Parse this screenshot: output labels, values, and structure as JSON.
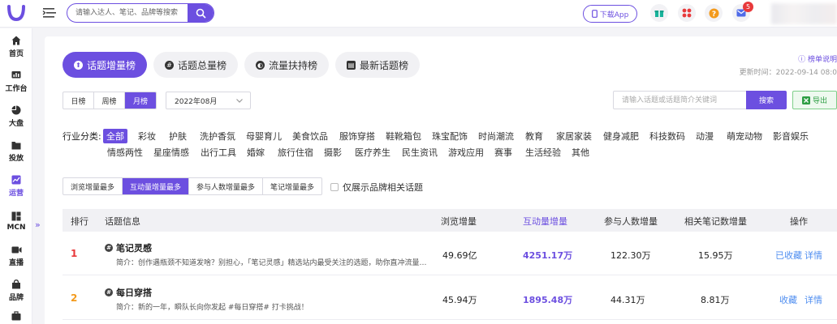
{
  "topbar": {
    "search_placeholder": "请输入达人、笔记、品牌等搜索",
    "download_label": "下载App",
    "notify_count": "5"
  },
  "sidebar": {
    "items": [
      {
        "label": "首页",
        "icon": "home-icon"
      },
      {
        "label": "工作台",
        "icon": "dashboard-icon"
      },
      {
        "label": "大盘",
        "icon": "pie-chart-icon"
      },
      {
        "label": "投放",
        "icon": "folder-icon"
      },
      {
        "label": "运营",
        "icon": "trend-icon"
      },
      {
        "label": "MCN",
        "icon": "mcn-icon"
      },
      {
        "label": "直播",
        "icon": "video-icon"
      },
      {
        "label": "品牌",
        "icon": "brand-icon"
      }
    ],
    "expand_glyph": "»"
  },
  "tabs": [
    {
      "label": "话题增量榜",
      "icon": "⬆"
    },
    {
      "label": "话题总量榜",
      "icon": "#"
    },
    {
      "label": "流量扶持榜",
      "icon": "◐"
    },
    {
      "label": "最新话题榜",
      "icon": "▤"
    }
  ],
  "header": {
    "rank_rule": "ⓘ 榜单说明",
    "updated": "更新时间：2022-09-14 08:0"
  },
  "period": {
    "options": [
      "日榜",
      "周榜",
      "月榜"
    ],
    "selected": "月榜"
  },
  "month": "2022年08月",
  "keyword": {
    "placeholder": "请输入话题或话题简介关键词",
    "search_label": "搜索",
    "export_label": "导出"
  },
  "industry": {
    "label": "行业分类:",
    "row1": [
      "全部",
      "彩妆",
      "护肤",
      "洗护香氛",
      "母婴育儿",
      "美食饮品",
      "服饰穿搭",
      "鞋靴箱包",
      "珠宝配饰",
      "时尚潮流",
      "教育",
      "家居家装",
      "健身减肥",
      "科技数码",
      "动漫",
      "萌宠动物",
      "影音娱乐"
    ],
    "row2": [
      "情感两性",
      "星座情感",
      "出行工具",
      "婚嫁",
      "旅行住宿",
      "摄影",
      "医疗养生",
      "民生资讯",
      "游戏应用",
      "赛事",
      "生活经验",
      "其他"
    ]
  },
  "sort_tabs": [
    "浏览增量最多",
    "互动量增量最多",
    "参与人数增量最多",
    "笔记增量最多"
  ],
  "brand_only_label": "仅展示品牌相关话题",
  "table": {
    "headers": [
      "排行",
      "话题信息",
      "浏览增量",
      "互动量增量",
      "参与人数增量",
      "相关笔记数增量",
      "操作"
    ],
    "rows": [
      {
        "rank": "1",
        "name": "笔记灵感",
        "intro": "简介：创作遇瓶颈不知道发啥？别担心，「笔记灵感」精选站内最受关注的选题，助你直冲流量…",
        "views": "49.69亿",
        "interactions": "4251.17万",
        "participants": "122.30万",
        "notes": "15.95万",
        "action1": "已收藏",
        "action2": "详情"
      },
      {
        "rank": "2",
        "name": "每日穿搭",
        "intro": "简介：新的一年，瞬队长向你发起 #每日穿搭# 打卡挑战！",
        "views": "45.94万",
        "interactions": "1895.48万",
        "participants": "44.31万",
        "notes": "8.81万",
        "action1": "收藏",
        "action2": "详情"
      }
    ]
  },
  "colors": {
    "accent": "#6c4fe0",
    "rank1": "#e8393b",
    "rank2": "#f39a1c",
    "link": "#4f8ef0"
  }
}
